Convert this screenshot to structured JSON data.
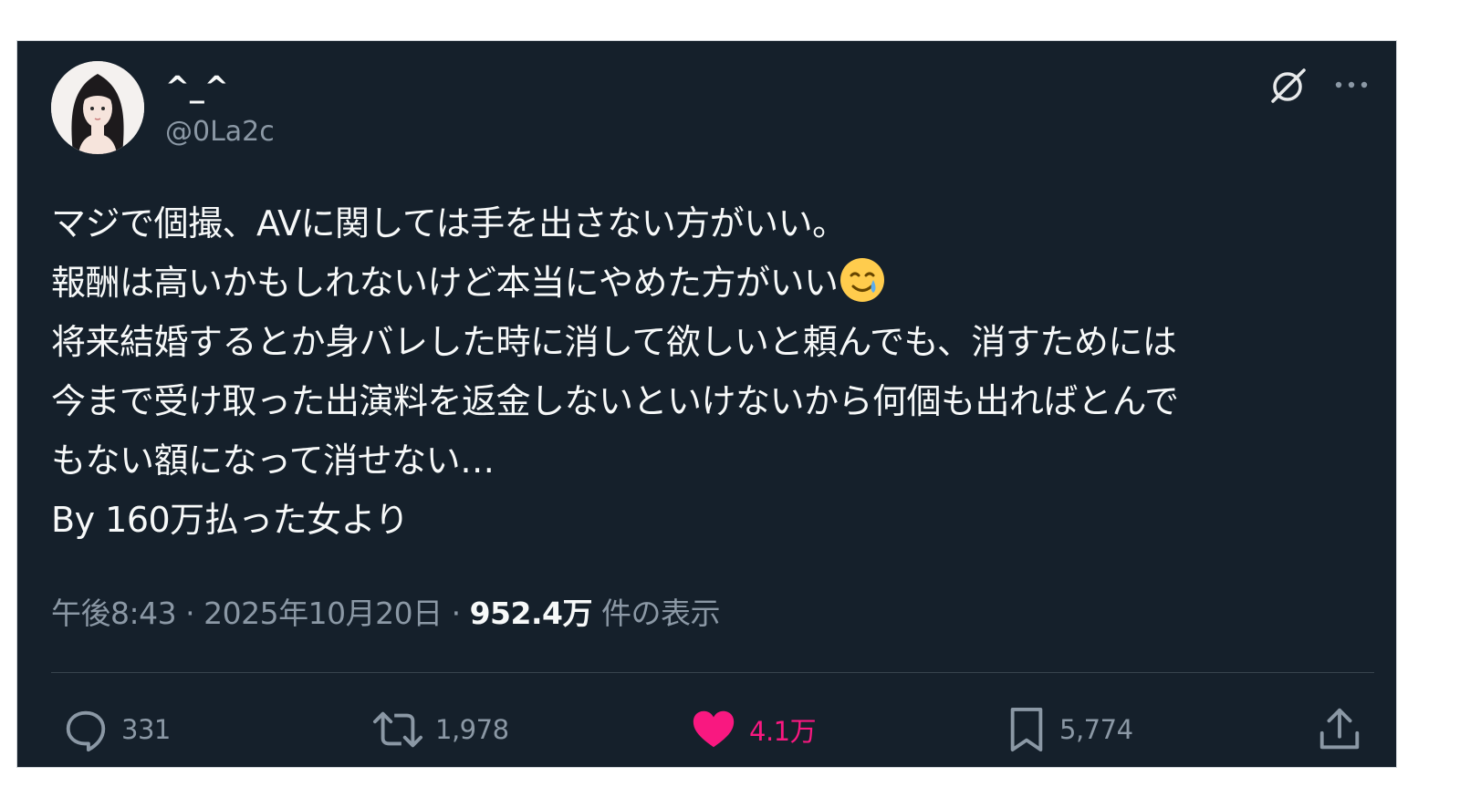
{
  "post": {
    "author": {
      "display_name": "^_^",
      "handle": "@0La2c"
    },
    "text_lines": [
      "マジで個撮、AVに関しては手を出さない方がいい。",
      "報酬は高いかもしれないけど本当にやめた方がいい",
      "将来結婚するとか身バレした時に消して欲しいと頼んでも、消すためには",
      "今まで受け取った出演料を返金しないといけないから何個も出ればとんで",
      "もない額になって消せない…",
      "By 160万払った女より"
    ],
    "emoji_icon": "crying-smile-emoji",
    "timestamp": "午後8:43",
    "date": "2025年10月20日",
    "separator": "·",
    "views_count": "952.4万",
    "views_label": "件の表示"
  },
  "actions": {
    "reply_count": "331",
    "retweet_count": "1,978",
    "like_count": "4.1万",
    "bookmark_count": "5,774"
  },
  "icons": {
    "grok": "grok-icon",
    "more": "more-icon",
    "reply": "reply-icon",
    "retweet": "retweet-icon",
    "like": "heart-icon",
    "bookmark": "bookmark-icon",
    "share": "share-icon"
  },
  "colors": {
    "background": "#15202b",
    "text": "#f7f9f9",
    "secondary": "#8b98a5",
    "like": "#f91880",
    "divider": "#38444d"
  }
}
